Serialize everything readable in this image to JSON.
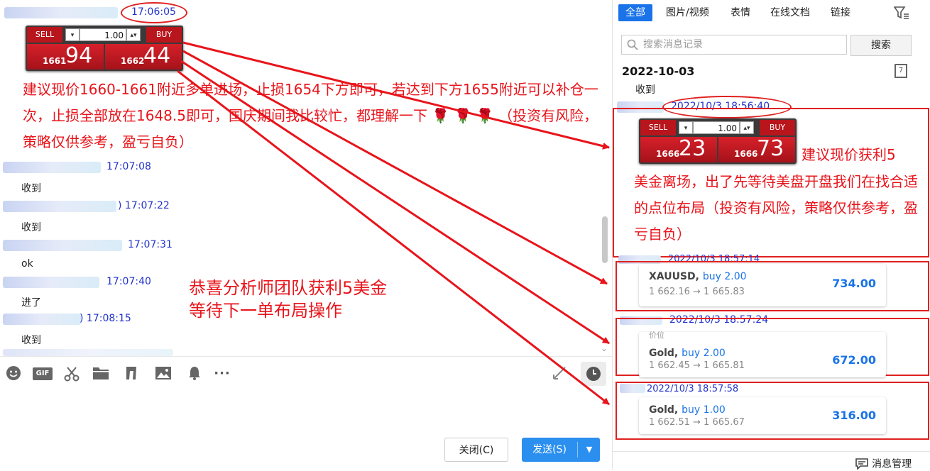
{
  "chat": {
    "first_time": "17:06:05",
    "widget1": {
      "sell": "SELL",
      "buy": "BUY",
      "lot": "1.00",
      "sell_small": "1661",
      "sell_big": "94",
      "buy_small": "1662",
      "buy_big": "44",
      "dropdown": "▾",
      "updown": "▴▾"
    },
    "advice_text": "建议现价1660-1661附近多单进场，止损1654下方即可，若达到下方1655附近可以补仓一次，止损全部放在1648.5即可，国庆期间我比较忙，都理解一下",
    "advice_tail": "（投资有风险，策略仅供参考，盈亏自负）",
    "messages": [
      {
        "time": "17:07:08",
        "text": "收到"
      },
      {
        "time": ")  17:07:22",
        "text": "收到"
      },
      {
        "time": "17:07:31",
        "text": "ok"
      },
      {
        "time": "17:07:40",
        "text": "进了"
      },
      {
        "time": ")  17:08:15",
        "text": "收到"
      }
    ],
    "annotation_line1": "恭喜分析师团队获利5美金",
    "annotation_line2": "等待下一单布局操作"
  },
  "toolbar": {
    "icons": [
      "emoji-icon",
      "gif-icon",
      "scissors-icon",
      "folder-icon",
      "music-icon",
      "image-icon",
      "bell-icon",
      "more-icon"
    ],
    "gif_label": "GIF",
    "close_label": "关闭(C)",
    "send_label": "发送(S)"
  },
  "history": {
    "tabs": [
      "全部",
      "图片/视频",
      "表情",
      "在线文档",
      "链接"
    ],
    "search_placeholder": "搜索消息记录",
    "search_button": "搜索",
    "date_heading": "2022-10-03",
    "first_msg": "收到",
    "profit_time": "2022/10/3 18:56:40",
    "widget2": {
      "sell": "SELL",
      "buy": "BUY",
      "lot": "1.00",
      "sell_small": "1666",
      "sell_big": "23",
      "buy_small": "1666",
      "buy_big": "73",
      "dropdown": "▾",
      "updown": "▴▾"
    },
    "profit_text_first": "建议现价获利5",
    "profit_text_rest": "美金离场，出了先等待美盘开盘我们在找合适的点位布局（投资有风险，策略仅供参考，盈亏自负）",
    "trades": [
      {
        "time": "2022/10/3 18:57:14",
        "symbol": "XAUUSD, ",
        "direction": "buy 2.00",
        "prices": "1 662.16 → 1 665.83",
        "profit": "734.00"
      },
      {
        "time": "2022/10/3 18:57:24",
        "symbol": "Gold, ",
        "direction": "buy 2.00",
        "prices": "1 662.45 → 1 665.81",
        "profit": "672.00",
        "partial": "价位"
      },
      {
        "time": "2022/10/3 18:57:58",
        "symbol": "Gold, ",
        "direction": "buy 1.00",
        "prices": "1 662.51 → 1 665.67",
        "profit": "316.00"
      }
    ],
    "manage_label": "消息管理",
    "calendar_day": "7"
  },
  "colors": {
    "accent": "#1a73e8",
    "red": "#e8141b",
    "time_blue": "#2233cc"
  }
}
